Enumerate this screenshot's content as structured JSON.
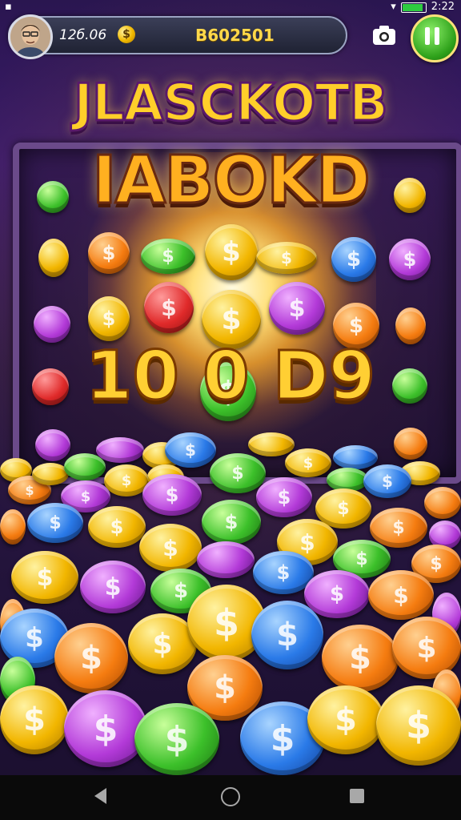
{
  "status_bar": {
    "time": "2:22",
    "battery_level": 0.95
  },
  "hud": {
    "level_text": "12б.06",
    "coin_symbol": "$",
    "coins_text": "B602501"
  },
  "titles": {
    "line_1": "JLASCKOTB",
    "line_2": "IABOKD",
    "center_numbers": "10 0 D9"
  },
  "icons": {
    "camera": "camera-icon",
    "pause": "pause-icon",
    "back": "nav-back-icon",
    "home": "nav-home-icon",
    "recents": "nav-recents-icon"
  },
  "coin_symbol": "$",
  "colors": {
    "gold": "#f2b600",
    "orange": "#f57c10",
    "green": "#3cc02a",
    "blue": "#2a7ae8",
    "purple": "#b33ad8",
    "red": "#e02a2a"
  }
}
